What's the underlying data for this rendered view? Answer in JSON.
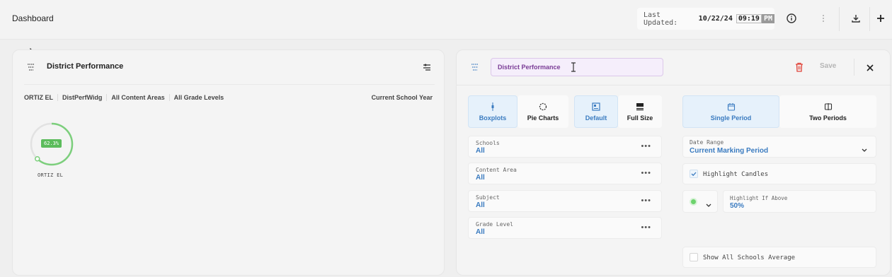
{
  "header": {
    "title": "Dashboard",
    "last_updated_label": "Last Updated:",
    "date": "10/22/24",
    "time": "09:19",
    "ampm": "PM",
    "icons": [
      "info-icon",
      "more-vertical-icon",
      "download-icon",
      "plus-icon"
    ]
  },
  "left_card": {
    "title": "District Performance",
    "chips": [
      "ORTIZ EL",
      "DistPerfWidg",
      "All Content Areas",
      "All Grade Levels"
    ],
    "period": "Current School Year",
    "gauge": {
      "value_label": "62.3%",
      "value": 62.3,
      "label": "ORTIZ EL",
      "color": "#5cbc5c"
    }
  },
  "editor": {
    "title_value": "District Performance",
    "save_label": "Save",
    "chart_types": [
      {
        "label": "Boxplots",
        "icon": "boxplot-icon",
        "active": true
      },
      {
        "label": "Pie Charts",
        "icon": "pie-chart-icon",
        "active": false
      }
    ],
    "sizes": [
      {
        "label": "Default",
        "icon": "default-size-icon",
        "active": true
      },
      {
        "label": "Full Size",
        "icon": "full-size-icon",
        "active": false
      }
    ],
    "filters": [
      {
        "label": "Schools",
        "value": "All"
      },
      {
        "label": "Content Area",
        "value": "All"
      },
      {
        "label": "Subject",
        "value": "All"
      },
      {
        "label": "Grade Level",
        "value": "All"
      }
    ],
    "periods": [
      {
        "label": "Single Period",
        "icon": "calendar-icon",
        "active": true
      },
      {
        "label": "Two Periods",
        "icon": "compare-icon",
        "active": false
      }
    ],
    "date_range": {
      "label": "Date Range",
      "value": "Current Marking Period"
    },
    "highlight_candles_label": "Highlight Candles",
    "highlight_above": {
      "label": "Highlight If Above",
      "value": "50%"
    },
    "show_all_label": "Show All Schools Average",
    "accent": "#3a7bc0"
  }
}
